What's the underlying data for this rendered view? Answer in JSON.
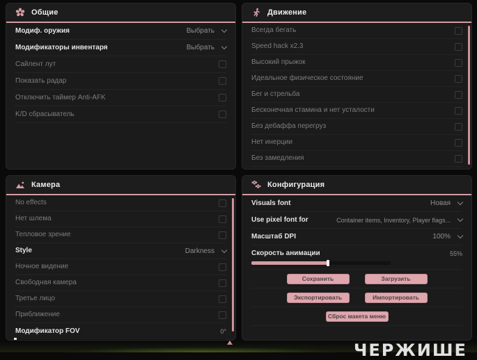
{
  "colors": {
    "accent": "#d59da4",
    "panel_bg": "#1b1b1b",
    "page_bg": "#0a0a0a",
    "button_pink": "#dfa6ad"
  },
  "panels": {
    "general": {
      "title": "Общие",
      "rows": [
        {
          "label": "Модиф. оружия",
          "type": "dropdown",
          "value": "Выбрать"
        },
        {
          "label": "Модификаторы инвентаря",
          "type": "dropdown",
          "value": "Выбрать"
        },
        {
          "label": "Сайлент лут",
          "type": "checkbox",
          "checked": false
        },
        {
          "label": "Показать радар",
          "type": "checkbox",
          "checked": false
        },
        {
          "label": "Отключить таймер Anti-AFK",
          "type": "checkbox",
          "checked": false
        },
        {
          "label": "K/D сбрасыватель",
          "type": "checkbox",
          "checked": false
        }
      ]
    },
    "movement": {
      "title": "Движение",
      "rows": [
        {
          "label": "Всегда бегать",
          "type": "checkbox",
          "checked": false
        },
        {
          "label": "Speed hack x2.3",
          "type": "checkbox",
          "checked": false
        },
        {
          "label": "Высокий прыжок",
          "type": "checkbox",
          "checked": false
        },
        {
          "label": "Идеальное физическое состояние",
          "type": "checkbox",
          "checked": false
        },
        {
          "label": "Бег и стрельба",
          "type": "checkbox",
          "checked": false
        },
        {
          "label": "Бесконечная стамина и нет усталости",
          "type": "checkbox",
          "checked": false
        },
        {
          "label": "Без дебаффа перегруз",
          "type": "checkbox",
          "checked": false
        },
        {
          "label": "Нет инерции",
          "type": "checkbox",
          "checked": false
        },
        {
          "label": "Без замедления",
          "type": "checkbox",
          "checked": false
        }
      ]
    },
    "camera": {
      "title": "Камера",
      "rows": [
        {
          "label": "No effects",
          "type": "checkbox",
          "checked": false
        },
        {
          "label": "Нет шлема",
          "type": "checkbox",
          "checked": false
        },
        {
          "label": "Тепловое зрение",
          "type": "checkbox",
          "checked": false
        },
        {
          "label": "Style",
          "type": "dropdown",
          "value": "Darkness"
        },
        {
          "label": "Ночное видение",
          "type": "checkbox",
          "checked": false
        },
        {
          "label": "Свободная камера",
          "type": "checkbox",
          "checked": false
        },
        {
          "label": "Третье лицо",
          "type": "checkbox",
          "checked": false
        },
        {
          "label": "Приближение",
          "type": "checkbox",
          "checked": false
        }
      ],
      "fov": {
        "label": "Модификатор FOV",
        "value": "0°",
        "percent": 0
      }
    },
    "config": {
      "title": "Конфигурация",
      "rows": [
        {
          "label": "Visuals font",
          "type": "dropdown",
          "value": "Новая"
        },
        {
          "label": "Use pixel font for",
          "type": "dropdown",
          "value": "Container items, Inventory, Player flags..."
        },
        {
          "label": "Масштаб DPI",
          "type": "dropdown",
          "value": "100%"
        }
      ],
      "animation": {
        "label": "Скорость анимации",
        "value": "55%",
        "percent": 55
      },
      "buttons": {
        "save": "Сохранить",
        "load": "Загрузить",
        "export": "Экспортировать",
        "import": "Импортировать",
        "reset": "Сброс макета меню"
      }
    }
  },
  "watermark": "ЧЕРЖИШЕ"
}
